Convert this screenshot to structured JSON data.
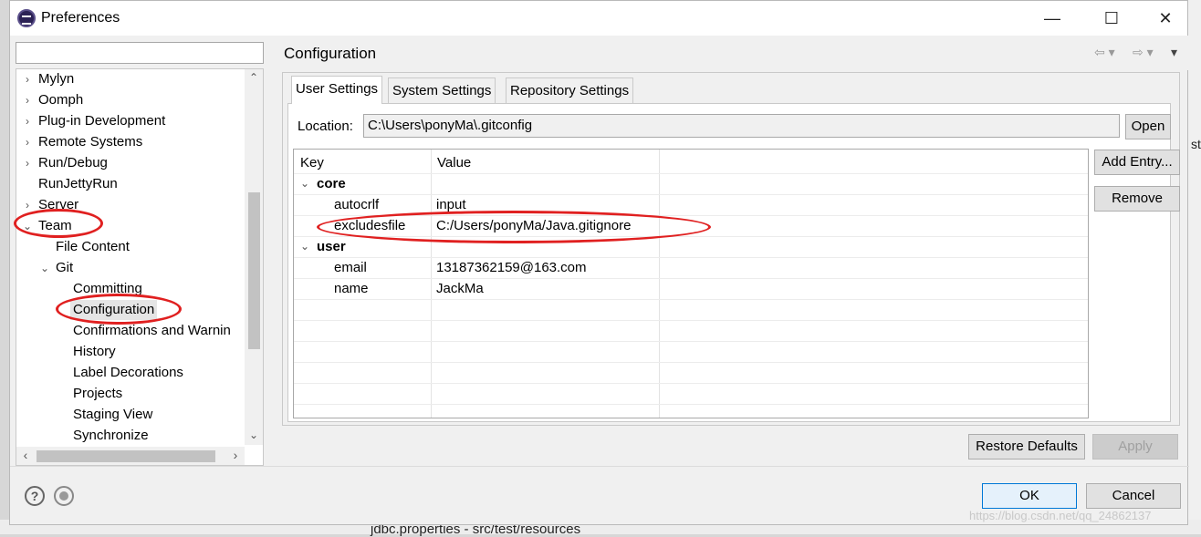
{
  "window": {
    "title": "Preferences",
    "minimize_glyph": "—",
    "maximize_glyph": "☐",
    "close_glyph": "✕"
  },
  "tree": {
    "filter_value": "",
    "items": [
      {
        "label": "Mylyn",
        "arrow": "›"
      },
      {
        "label": "Oomph",
        "arrow": "›"
      },
      {
        "label": "Plug-in Development",
        "arrow": "›"
      },
      {
        "label": "Remote Systems",
        "arrow": "›"
      },
      {
        "label": "Run/Debug",
        "arrow": "›"
      },
      {
        "label": "RunJettyRun",
        "arrow": ""
      },
      {
        "label": "Server",
        "arrow": "›"
      },
      {
        "label": "Team",
        "arrow": "⌄"
      },
      {
        "label": "File Content",
        "arrow": ""
      },
      {
        "label": "Git",
        "arrow": "⌄"
      },
      {
        "label": "Committing",
        "arrow": ""
      },
      {
        "label": "Configuration",
        "arrow": ""
      },
      {
        "label": "Confirmations and Warnin",
        "arrow": ""
      },
      {
        "label": "History",
        "arrow": ""
      },
      {
        "label": "Label Decorations",
        "arrow": ""
      },
      {
        "label": "Projects",
        "arrow": ""
      },
      {
        "label": "Staging View",
        "arrow": ""
      },
      {
        "label": "Synchronize",
        "arrow": ""
      }
    ]
  },
  "page": {
    "title": "Configuration",
    "tabs": [
      "User Settings",
      "System Settings",
      "Repository Settings"
    ],
    "location_label": "Location:",
    "location_value": "C:\\Users\\ponyMa\\.gitconfig",
    "open_button": "Open",
    "add_entry_button": "Add Entry...",
    "remove_button": "Remove",
    "restore_defaults_button": "Restore Defaults",
    "apply_button": "Apply"
  },
  "table": {
    "headers": [
      "Key",
      "Value"
    ],
    "rows": [
      {
        "key": "core",
        "value": "",
        "section": true
      },
      {
        "key": "autocrlf",
        "value": "input",
        "section": false
      },
      {
        "key": "excludesfile",
        "value": "C:/Users/ponyMa/Java.gitignore",
        "section": false
      },
      {
        "key": "user",
        "value": "",
        "section": true
      },
      {
        "key": "email",
        "value": "13187362159@163.com",
        "section": false
      },
      {
        "key": "name",
        "value": "JackMa",
        "section": false
      }
    ]
  },
  "footer": {
    "ok_button": "OK",
    "cancel_button": "Cancel"
  },
  "background": {
    "bottom_text": "jdbc.properties - src/test/resources",
    "right_text": "st",
    "watermark": "https://blog.csdn.net/qq_24862137"
  },
  "colors": {
    "annotation_red": "#e02020",
    "selection_gray": "#e5e5e5",
    "default_button_border": "#0078d7"
  }
}
